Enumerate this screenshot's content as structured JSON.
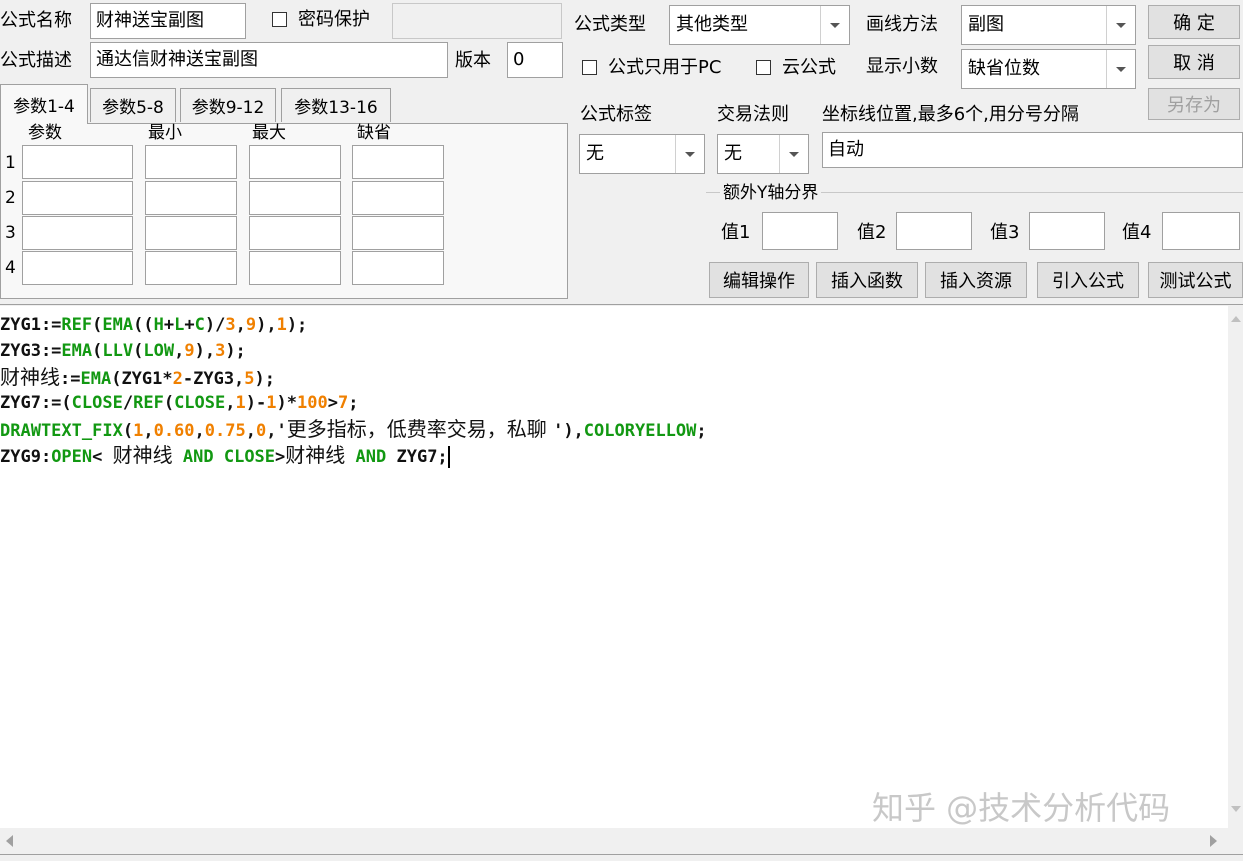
{
  "formula": {
    "name_label": "公式名称",
    "name_value": "财神送宝副图",
    "password_label": "密码保护",
    "desc_label": "公式描述",
    "desc_value": "通达信财神送宝副图",
    "version_label": "版本",
    "version_value": "0",
    "type_label": "公式类型",
    "type_value": "其他类型",
    "draw_label": "画线方法",
    "draw_value": "副图",
    "pc_only_label": "公式只用于PC",
    "cloud_label": "云公式",
    "decimal_label": "显示小数",
    "decimal_value": "缺省位数",
    "tag_label": "公式标签",
    "tag_value": "无",
    "rule_label": "交易法则",
    "rule_value": "无",
    "axis_label": "坐标线位置,最多6个,用分号分隔",
    "axis_value": "自动",
    "extra_y_label": "额外Y轴分界",
    "val_labels": [
      "值1",
      "值2",
      "值3",
      "值4"
    ]
  },
  "buttons": {
    "ok": "确 定",
    "cancel": "取 消",
    "save_as": "另存为",
    "edit_ops": "编辑操作",
    "insert_func": "插入函数",
    "insert_res": "插入资源",
    "import_formula": "引入公式",
    "test_formula": "测试公式"
  },
  "params": {
    "tabs": [
      "参数1-4",
      "参数5-8",
      "参数9-12",
      "参数13-16"
    ],
    "headers": [
      "参数",
      "最小",
      "最大",
      "缺省"
    ],
    "rows": [
      "1",
      "2",
      "3",
      "4"
    ]
  },
  "code_lines": [
    [
      [
        "p",
        "ZYG1:="
      ],
      [
        "k",
        "REF"
      ],
      [
        "p",
        "("
      ],
      [
        "k",
        "EMA"
      ],
      [
        "p",
        "(("
      ],
      [
        "k",
        "H"
      ],
      [
        "p",
        "+"
      ],
      [
        "k",
        "L"
      ],
      [
        "p",
        "+"
      ],
      [
        "k",
        "C"
      ],
      [
        "p",
        ")/"
      ],
      [
        "n",
        "3"
      ],
      [
        "p",
        ","
      ],
      [
        "n",
        "9"
      ],
      [
        "p",
        "),"
      ],
      [
        "n",
        "1"
      ],
      [
        "p",
        ");"
      ]
    ],
    [
      [
        "p",
        "ZYG3:="
      ],
      [
        "k",
        "EMA"
      ],
      [
        "p",
        "("
      ],
      [
        "k",
        "LLV"
      ],
      [
        "p",
        "("
      ],
      [
        "k",
        "LOW"
      ],
      [
        "p",
        ","
      ],
      [
        "n",
        "9"
      ],
      [
        "p",
        "),"
      ],
      [
        "n",
        "3"
      ],
      [
        "p",
        ");"
      ]
    ],
    [
      [
        "t",
        "财神线"
      ],
      [
        "p",
        ":="
      ],
      [
        "k",
        "EMA"
      ],
      [
        "p",
        "(ZYG1*"
      ],
      [
        "n",
        "2"
      ],
      [
        "p",
        "-ZYG3,"
      ],
      [
        "n",
        "5"
      ],
      [
        "p",
        ");"
      ]
    ],
    [
      [
        "p",
        "ZYG7:=("
      ],
      [
        "k",
        "CLOSE"
      ],
      [
        "p",
        "/"
      ],
      [
        "k",
        "REF"
      ],
      [
        "p",
        "("
      ],
      [
        "k",
        "CLOSE"
      ],
      [
        "p",
        ","
      ],
      [
        "n",
        "1"
      ],
      [
        "p",
        ")-"
      ],
      [
        "n",
        "1"
      ],
      [
        "p",
        ")*"
      ],
      [
        "n",
        "100"
      ],
      [
        "p",
        ">"
      ],
      [
        "n",
        "7"
      ],
      [
        "p",
        ";"
      ]
    ],
    [
      [
        "k",
        "DRAWTEXT_FIX"
      ],
      [
        "p",
        "("
      ],
      [
        "n",
        "1"
      ],
      [
        "p",
        ","
      ],
      [
        "n",
        "0.60"
      ],
      [
        "p",
        ","
      ],
      [
        "n",
        "0.75"
      ],
      [
        "p",
        ","
      ],
      [
        "n",
        "0"
      ],
      [
        "p",
        ",'"
      ],
      [
        "t",
        "更多指标，低费率交易，私聊 "
      ],
      [
        "p",
        "'),"
      ],
      [
        "k",
        "COLORYELLOW"
      ],
      [
        "p",
        ";"
      ]
    ],
    [
      [
        "p",
        "ZYG9:"
      ],
      [
        "k",
        "OPEN"
      ],
      [
        "p",
        "< "
      ],
      [
        "t",
        "财神线"
      ],
      [
        "p",
        " "
      ],
      [
        "k",
        "AND"
      ],
      [
        "p",
        " "
      ],
      [
        "k",
        "CLOSE"
      ],
      [
        "p",
        ">"
      ],
      [
        "t",
        "财神线"
      ],
      [
        "p",
        " "
      ],
      [
        "k",
        "AND"
      ],
      [
        "p",
        " ZYG7;"
      ]
    ]
  ],
  "watermark": "知乎 @技术分析代码"
}
